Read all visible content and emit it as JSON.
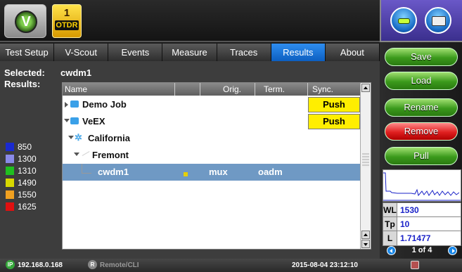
{
  "header": {
    "app_icon": "veex-logo-icon",
    "app_icon_glyph": "V",
    "mode_number": "1",
    "mode_label": "OTDR"
  },
  "right_panel": {
    "top_buttons": [
      "minus-icon",
      "folder-icon"
    ],
    "buttons": [
      "Save",
      "Load",
      "Rename",
      "Remove",
      "Pull"
    ],
    "wl_label": "WL",
    "wl_value": "1530",
    "tp_label": "Tp",
    "tp_value": "10",
    "l_label": "L",
    "l_value": "1.71477",
    "page_indicator": "1 of 4"
  },
  "tabs": [
    "Test Setup",
    "V-Scout",
    "Events",
    "Measure",
    "Traces",
    "Results",
    "About"
  ],
  "active_tab": "Results",
  "selected_label": "Selected:",
  "selected_value": "cwdm1",
  "results_label": "Results:",
  "legend": [
    {
      "label": "850",
      "color": "#1a2ad0"
    },
    {
      "label": "1300",
      "color": "#8a8ae8"
    },
    {
      "label": "1310",
      "color": "#20c020"
    },
    {
      "label": "1490",
      "color": "#d8d800"
    },
    {
      "label": "1550",
      "color": "#f0a020"
    },
    {
      "label": "1625",
      "color": "#e01010"
    }
  ],
  "table": {
    "columns": [
      "Name",
      "Orig.",
      "Term.",
      "Sync."
    ],
    "rows": [
      {
        "name": "Demo Job",
        "orig": "",
        "term": "",
        "sync": "Push"
      },
      {
        "name": "VeEX",
        "orig": "",
        "term": "",
        "sync": "Push"
      },
      {
        "name": "California",
        "orig": "",
        "term": "",
        "sync": ""
      },
      {
        "name": "Fremont",
        "orig": "",
        "term": "",
        "sync": ""
      },
      {
        "name": "cwdm1",
        "orig": "mux",
        "term": "oadm",
        "sync": ""
      }
    ]
  },
  "status_bar": {
    "ip_badge": "IP",
    "ip": "192.168.0.168",
    "remote_badge": "R",
    "remote": "Remote/CLI",
    "datetime": "2015-08-04 23:12:10"
  },
  "colors": {
    "active_tab": "#1a75d8",
    "selected_row": "#6f99c4",
    "push_bg": "#ffee00",
    "button_green": "#3b9a1c",
    "button_red": "#e02020"
  }
}
